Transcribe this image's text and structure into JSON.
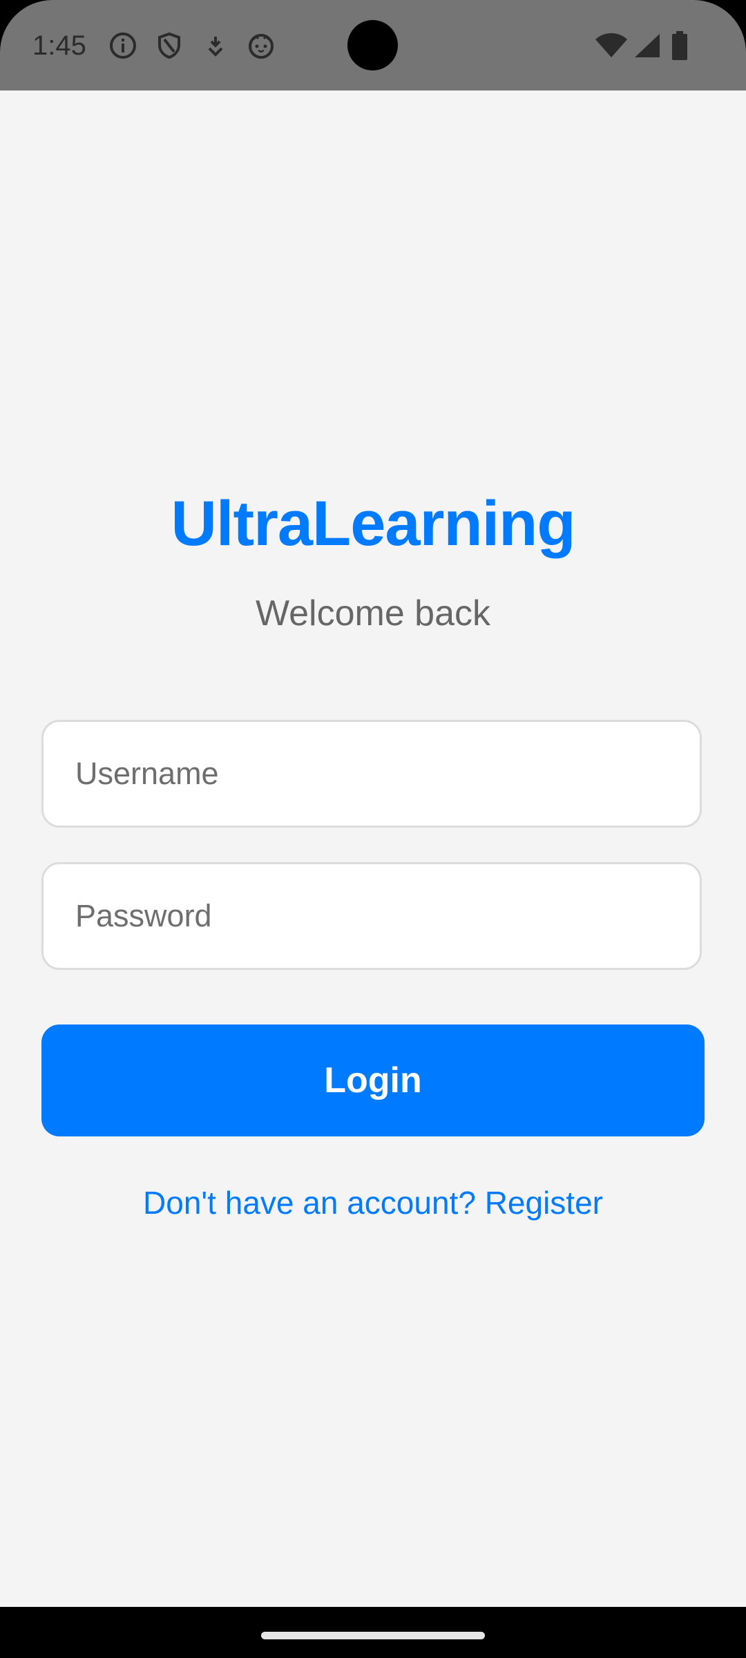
{
  "status_bar": {
    "time": "1:45",
    "left_icons": [
      "info-icon",
      "shield-icon",
      "download-icon",
      "cat-icon"
    ],
    "right_icons": [
      "wifi-icon",
      "cell-signal-icon",
      "battery-icon"
    ]
  },
  "app": {
    "title": "UltraLearning",
    "subtitle": "Welcome back",
    "username": {
      "placeholder": "Username",
      "value": ""
    },
    "password": {
      "placeholder": "Password",
      "value": ""
    },
    "login_label": "Login",
    "register_link": "Don't have an account? Register"
  },
  "colors": {
    "accent": "#007aff",
    "background": "#f4f4f4",
    "status_bar": "#757575",
    "subtitle_text": "#666666",
    "field_border": "#dcdcdc"
  }
}
